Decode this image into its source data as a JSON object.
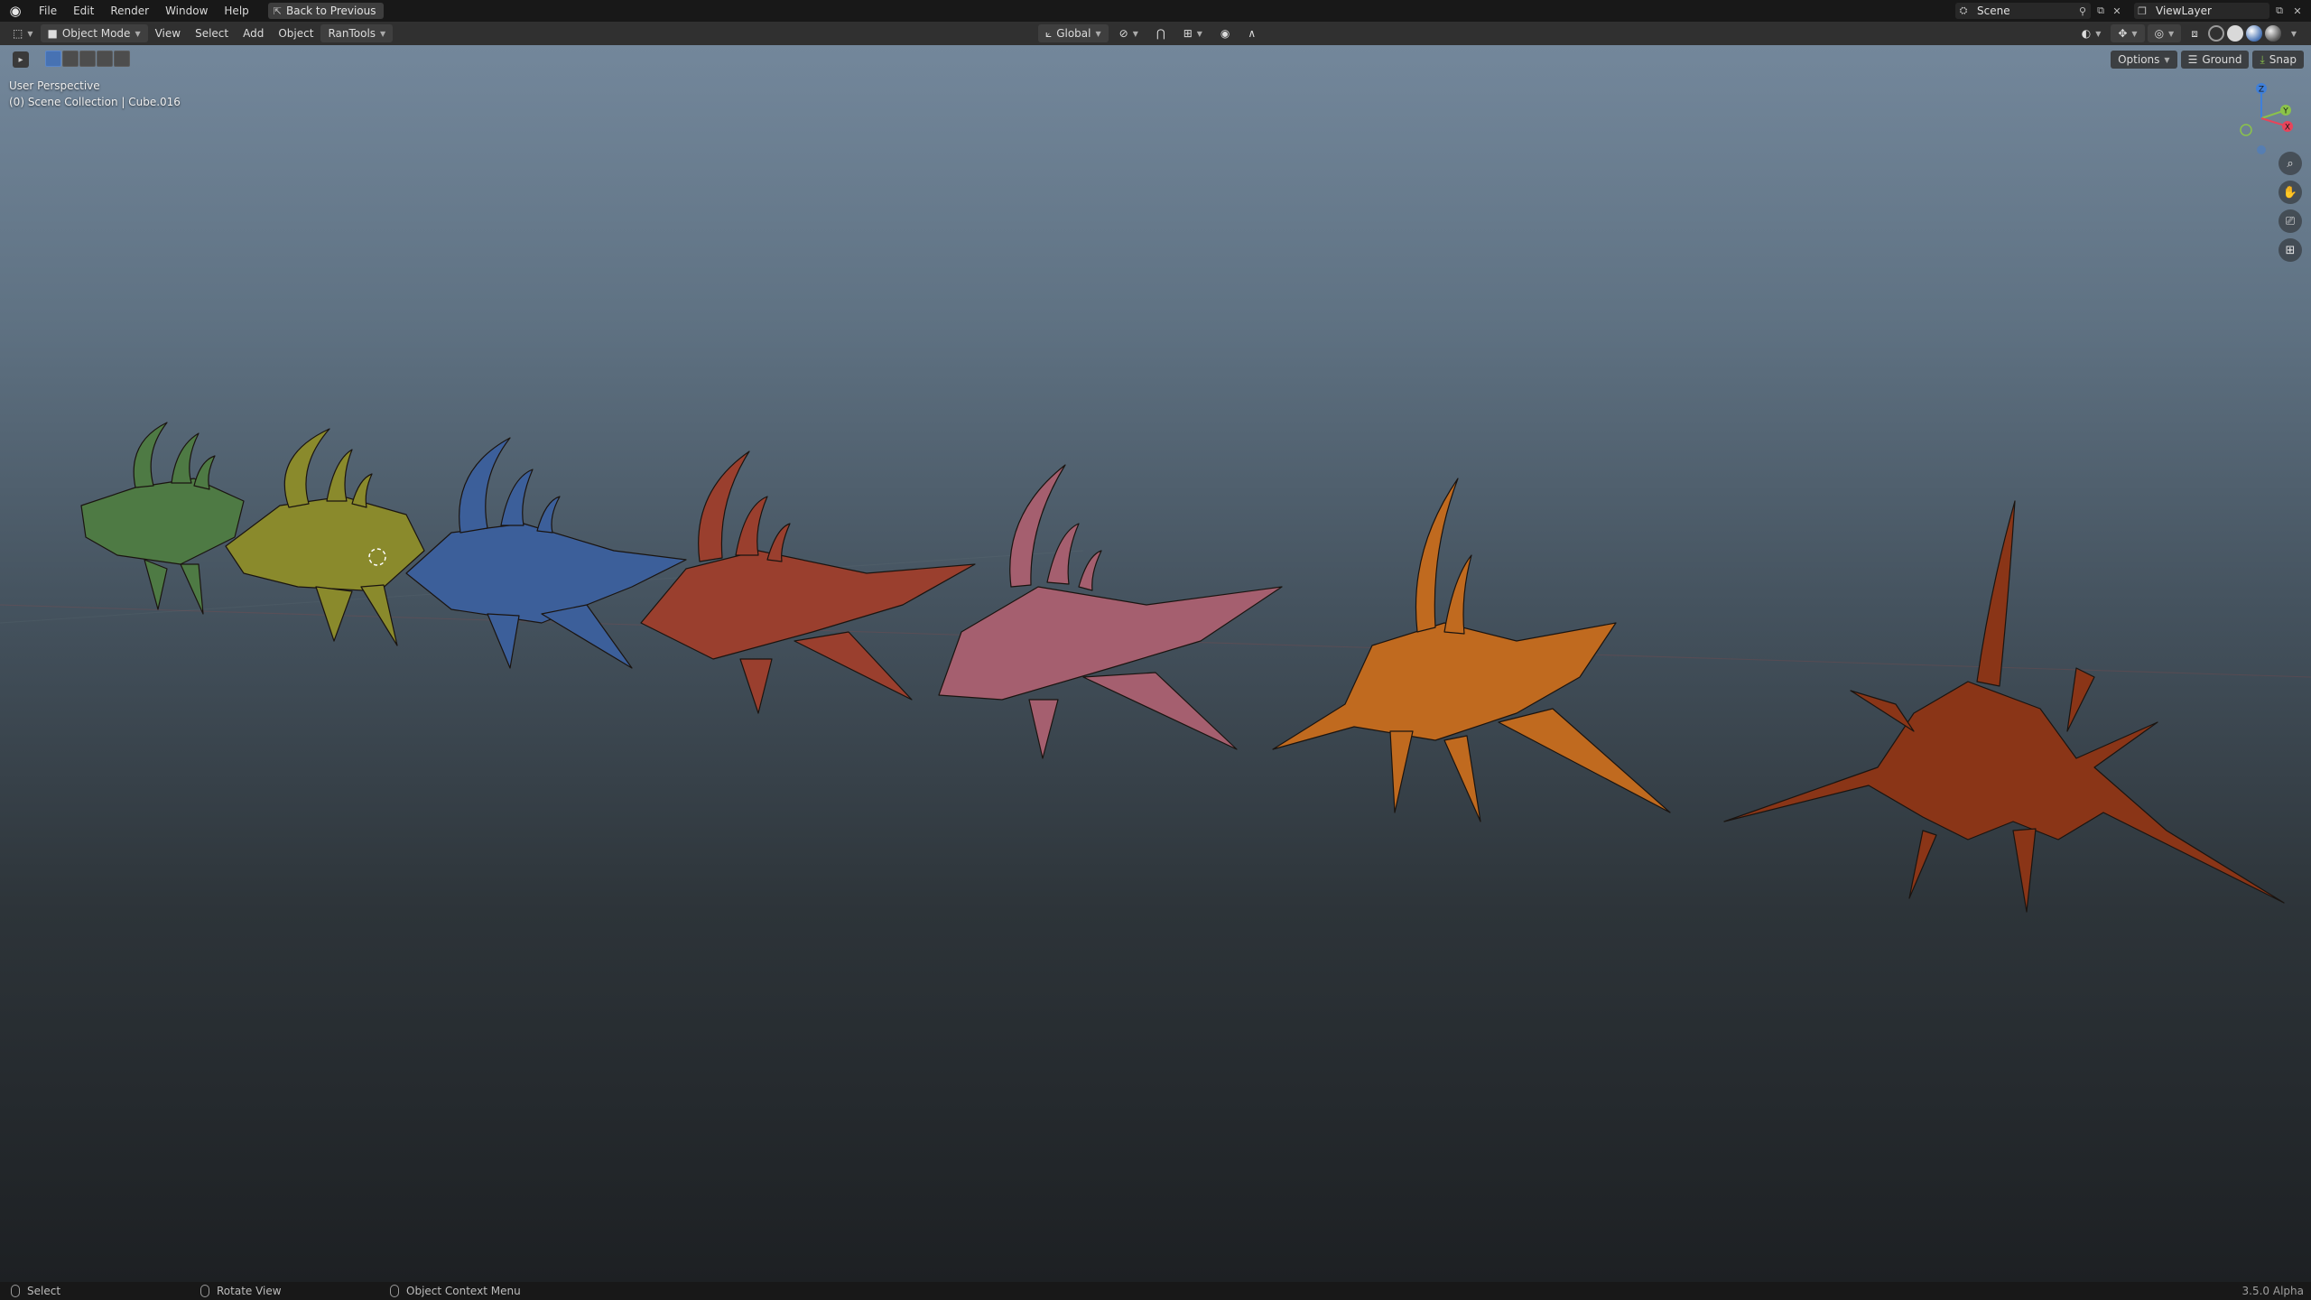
{
  "menubar": {
    "logo_icon": "blender-icon",
    "menus": [
      "File",
      "Edit",
      "Render",
      "Window",
      "Help"
    ],
    "back_button": "Back to Previous",
    "scene_label": "Scene",
    "view_layer_label": "ViewLayer"
  },
  "header": {
    "editor_type_icon": "view3d-icon",
    "mode": "Object Mode",
    "menus": [
      "View",
      "Select",
      "Add",
      "Object"
    ],
    "addon_menu": "RanTools",
    "orientation": "Global"
  },
  "toolrow": {
    "options": "Options",
    "ground": "Ground",
    "snap": "Snap"
  },
  "viewport": {
    "perspective": "User Perspective",
    "collection": "(0) Scene Collection | Cube.016",
    "gizmo": {
      "x": "X",
      "y": "Y",
      "z": "Z",
      "x_color": "#e8445a",
      "y_color": "#8bc34a",
      "z_color": "#3f7fd9"
    },
    "nav_icons": [
      "zoom-icon",
      "pan-hand-icon",
      "camera-icon",
      "grid-icon"
    ],
    "creatures": [
      {
        "color": "#4e7a44"
      },
      {
        "color": "#8a8a2c"
      },
      {
        "color": "#3c5f9a"
      },
      {
        "color": "#9a3f2e"
      },
      {
        "color": "#a55f6f"
      },
      {
        "color": "#c06a1f"
      },
      {
        "color": "#8a3517"
      }
    ]
  },
  "statusbar": {
    "select": "Select",
    "rotate": "Rotate View",
    "context_menu": "Object Context Menu",
    "version": "3.5.0 Alpha"
  },
  "colors": {
    "accent": "#4772b3",
    "bg_top": "#73879b",
    "bg_bottom": "#1d2023"
  }
}
